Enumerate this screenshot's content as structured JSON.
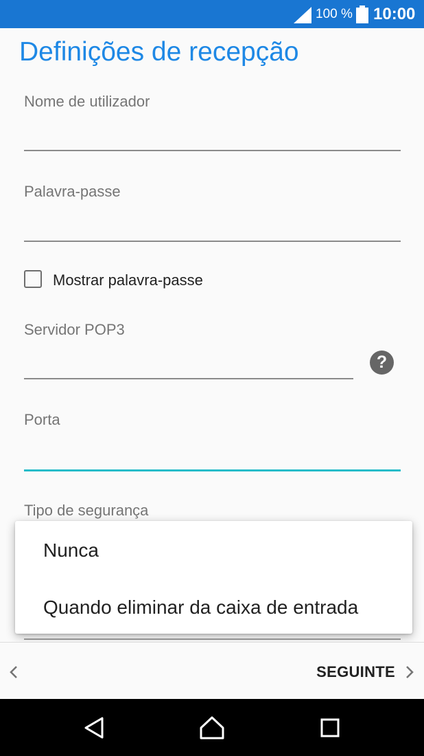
{
  "status_bar": {
    "battery_percent": "100 %",
    "time": "10:00",
    "icons": [
      "signal-icon",
      "battery-icon"
    ]
  },
  "page": {
    "title": "Definições de recepção"
  },
  "fields": {
    "username_label": "Nome de utilizador",
    "password_label": "Palavra-passe",
    "server_label": "Servidor POP3",
    "port_label": "Porta",
    "security_label": "Tipo de segurança"
  },
  "checkbox": {
    "show_password_label": "Mostrar palavra-passe",
    "checked": false
  },
  "help": {
    "glyph": "?"
  },
  "popup_menu": {
    "items": [
      "Nunca",
      "Quando eliminar da caixa de entrada"
    ]
  },
  "action_bar": {
    "next_label": "SEGUINTE"
  },
  "nav_bar": {
    "buttons": [
      "back-icon",
      "home-icon",
      "recents-icon"
    ]
  },
  "colors": {
    "status_bar": "#1976d2",
    "title": "#1e88e5",
    "focus_underline": "#26bcc9",
    "background": "#fafafa"
  }
}
